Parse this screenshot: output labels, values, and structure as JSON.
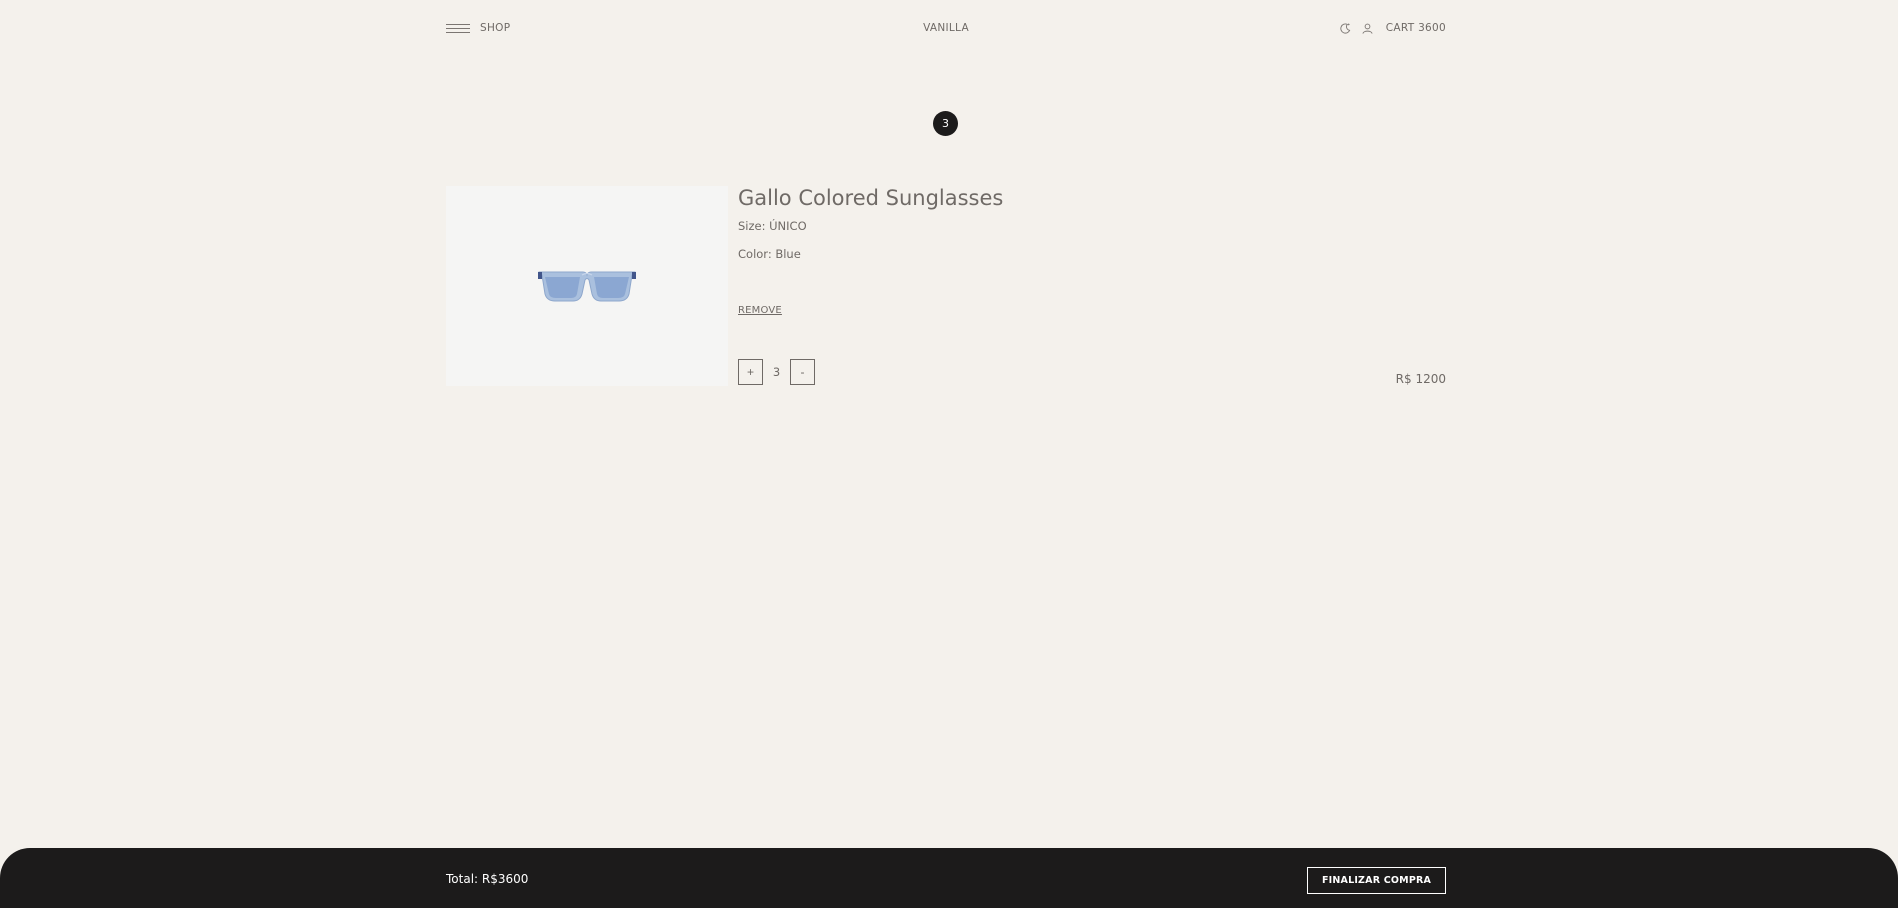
{
  "header": {
    "menu_label": "SHOP",
    "brand": "VANILLA",
    "cart_label": "CART 3600",
    "icons": [
      "hamburger-icon",
      "theme-toggle-icon",
      "user-icon"
    ]
  },
  "cart": {
    "count": "3",
    "item": {
      "title": "Gallo Colored Sunglasses",
      "size": "Size: ÚNICO",
      "color": "Color: Blue",
      "remove_label": "REMOVE",
      "plus_label": "+",
      "quantity": "3",
      "minus_label": "-",
      "price": "R$ 1200"
    }
  },
  "footer": {
    "total": "Total: R$3600",
    "checkout_label": "FINALIZAR COMPRA"
  },
  "colors": {
    "background": "#f4f1ec",
    "text": "#6f6a66",
    "dark": "#1c1b1b",
    "lens": "#8fa9cf"
  }
}
